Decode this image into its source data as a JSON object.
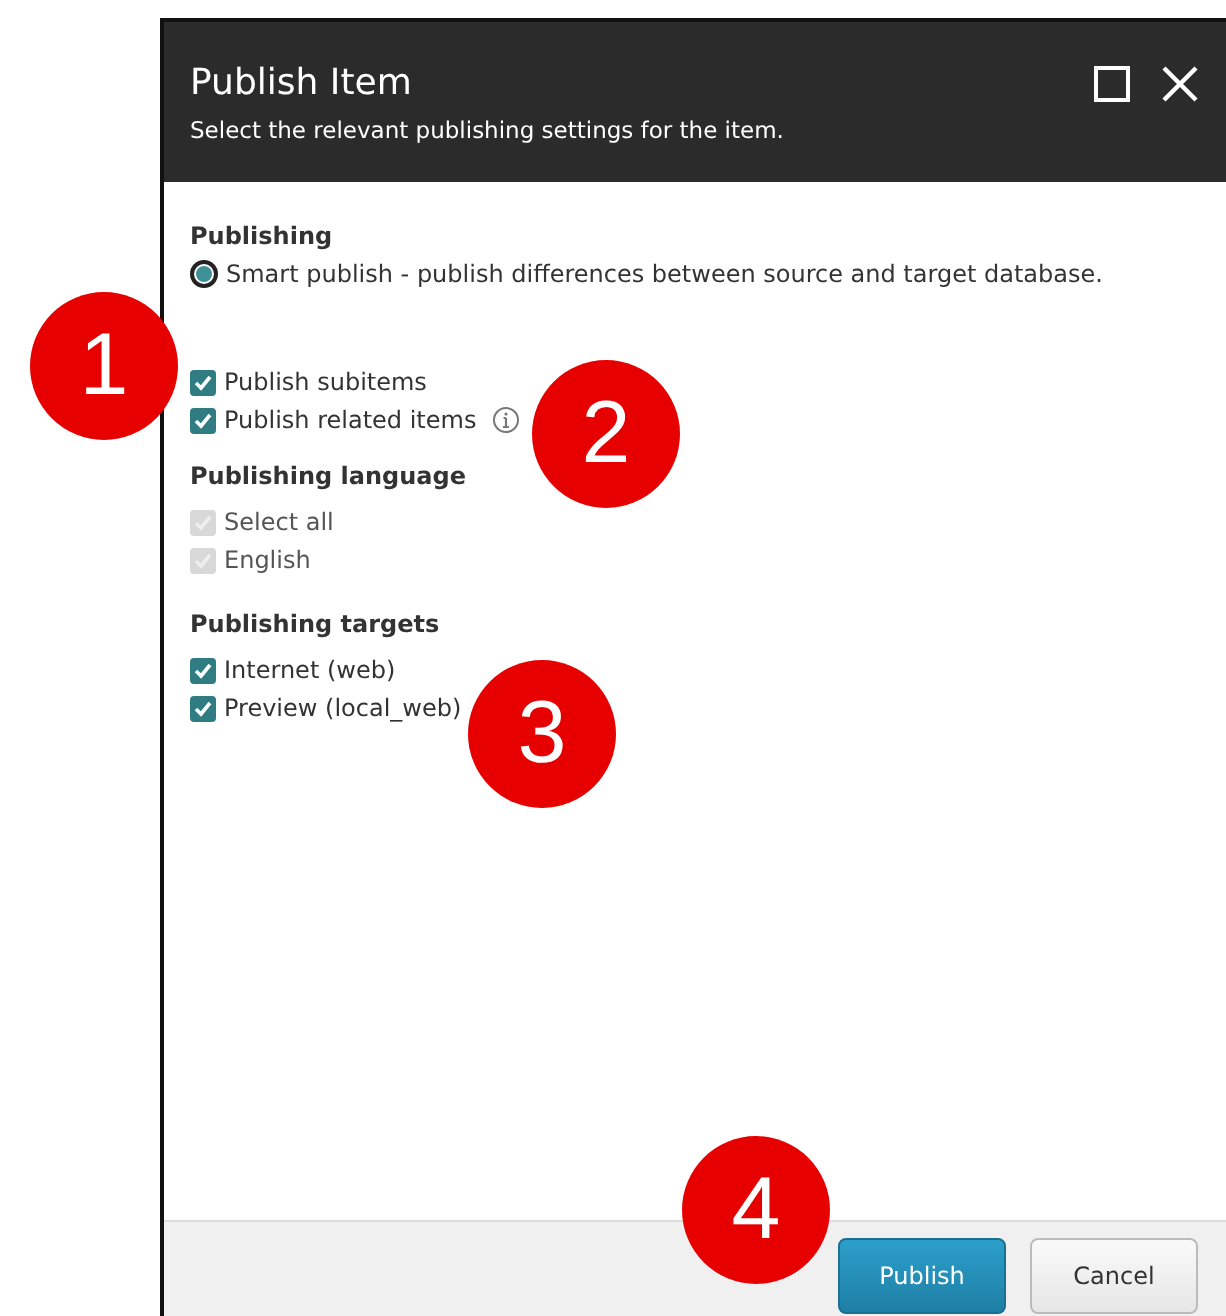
{
  "dialog": {
    "title": "Publish Item",
    "subtitle": "Select the relevant publishing settings for the item."
  },
  "sections": [
    {
      "heading": "Publishing",
      "items": [
        {
          "kind": "radio",
          "label": "Smart publish - publish differences between source and target database.",
          "selected": true,
          "disabled": false
        }
      ]
    },
    {
      "items": [
        {
          "kind": "checkbox",
          "label": "Publish subitems",
          "checked": true,
          "disabled": false,
          "info": false
        },
        {
          "kind": "checkbox",
          "label": "Publish related items",
          "checked": true,
          "disabled": false,
          "info": true
        }
      ]
    },
    {
      "heading": "Publishing language",
      "items": [
        {
          "kind": "checkbox",
          "label": "Select all",
          "checked": true,
          "disabled": true,
          "info": false
        },
        {
          "kind": "checkbox",
          "label": "English",
          "checked": true,
          "disabled": true,
          "info": false
        }
      ]
    },
    {
      "heading": "Publishing targets",
      "items": [
        {
          "kind": "checkbox",
          "label": "Internet (web)",
          "checked": true,
          "disabled": false,
          "info": false
        },
        {
          "kind": "checkbox",
          "label": "Preview (local_web)",
          "checked": true,
          "disabled": false,
          "info": false
        }
      ]
    }
  ],
  "buttons": [
    {
      "label": "Publish",
      "kind": "primary"
    },
    {
      "label": "Cancel",
      "kind": "secondary"
    }
  ],
  "callouts": [
    "1",
    "2",
    "3",
    "4"
  ]
}
